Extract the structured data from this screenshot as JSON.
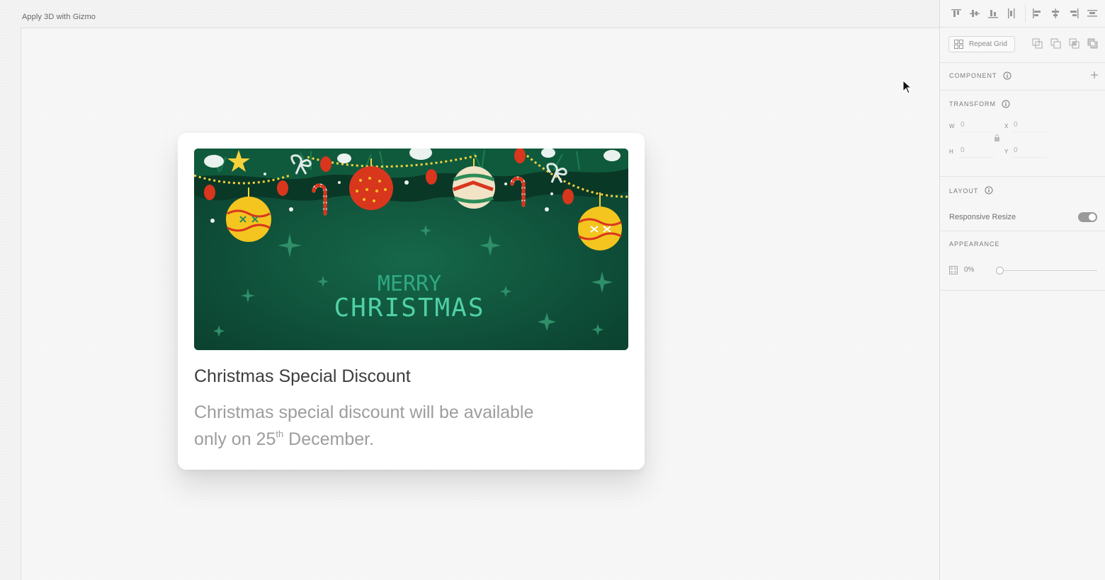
{
  "canvas": {
    "artboard_title": "Apply 3D with Gizmo"
  },
  "card": {
    "image_title_line1": "MERRY",
    "image_title_line2": "CHRISTMAS",
    "title": "Christmas Special Discount",
    "desc_line1": "Christmas special discount will be available",
    "desc_prefix": "only on 25",
    "desc_sup": "th",
    "desc_suffix": " December."
  },
  "panel": {
    "repeat_grid_label": "Repeat Grid",
    "component_label": "COMPONENT",
    "transform_label": "TRANSFORM",
    "transform": {
      "w_label": "W",
      "w_value": "0",
      "x_label": "X",
      "x_value": "0",
      "h_label": "H",
      "h_value": "0",
      "y_label": "Y",
      "y_value": "0"
    },
    "layout_label": "LAYOUT",
    "responsive_resize_label": "Responsive Resize",
    "responsive_resize_on": true,
    "appearance_label": "APPEARANCE",
    "opacity_value": "0%",
    "opacity_fraction": 0.0
  },
  "colors": {
    "card_image_bg": "#0d4b35",
    "title_text": "#4fd1a6",
    "ornament_red": "#d9361e",
    "ornament_yellow": "#f4c51f"
  },
  "icons": [
    "align-top-icon",
    "align-middle-icon",
    "align-bottom-icon",
    "distribute-vertical-icon",
    "align-left-icon",
    "align-center-icon",
    "align-right-icon",
    "distribute-horizontal-icon",
    "repeat-grid-icon",
    "boolean-add-icon",
    "boolean-subtract-icon",
    "boolean-intersect-icon",
    "boolean-exclude-icon",
    "info-icon",
    "plus-icon",
    "lock-icon",
    "opacity-icon",
    "cursor-icon"
  ]
}
